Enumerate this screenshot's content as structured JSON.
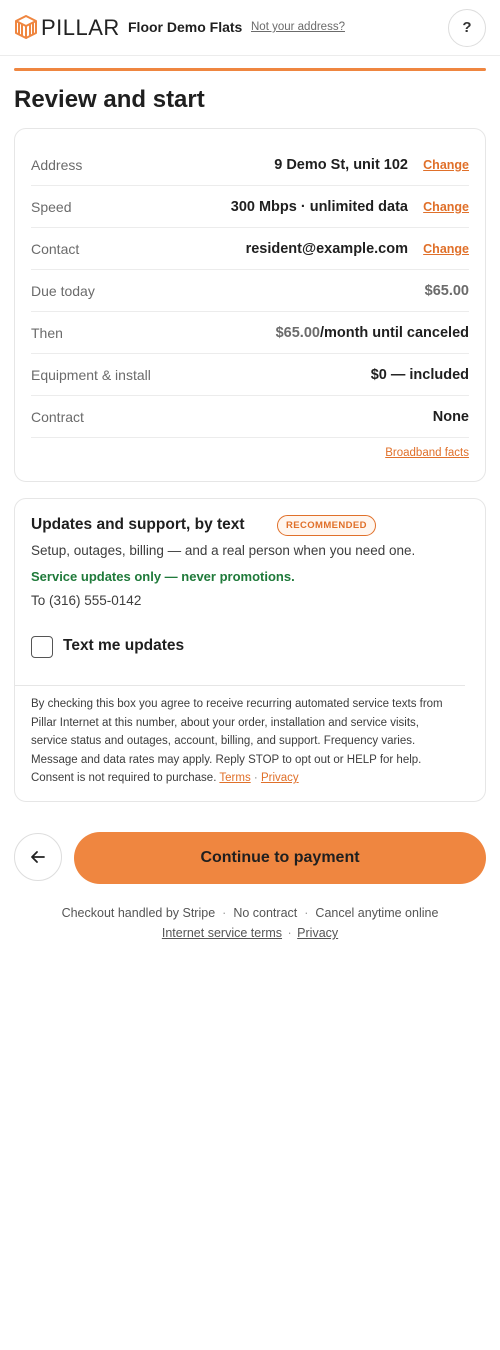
{
  "header": {
    "brand": "PILLAR",
    "property": "Floor Demo Flats",
    "not_address_link": "Not your address?",
    "help_label": "?"
  },
  "page_title": "Review and start",
  "review": {
    "rows": [
      {
        "label": "Address",
        "value": "9 Demo St, unit 102",
        "action": "Change"
      },
      {
        "label": "Speed",
        "value": "300 Mbps · unlimited data",
        "action": "Change"
      },
      {
        "label": "Contact",
        "value": "resident@example.com",
        "action": "Change"
      },
      {
        "label": "Due today",
        "value": "$65.00"
      },
      {
        "label": "Then",
        "value_price": "$65.00",
        "value_suffix": "/month until canceled"
      },
      {
        "label": "Equipment & install",
        "value": "$0 — included"
      },
      {
        "label": "Contract",
        "value": "None"
      }
    ],
    "broadband_link": "Broadband facts"
  },
  "sms": {
    "title": "Updates and support, by text",
    "badge": "RECOMMENDED",
    "description": "Setup, outages, billing — and a real person when you need one.",
    "note": "Service updates only — never promotions.",
    "to": "To (316) 555-0142",
    "checkbox_label": "Text me updates",
    "checkbox_checked": false,
    "consent_text": "By checking this box you agree to receive recurring automated service texts from Pillar Internet at this number, about your order, installation and service visits, service status and outages, account, billing, and support. Frequency varies. Message and data rates may apply. Reply STOP to opt out or HELP for help. Consent is not required to purchase.",
    "terms_link": "Terms",
    "privacy_link": "Privacy",
    "separator": "·"
  },
  "actions": {
    "back_icon": "arrow-left-icon",
    "continue_label": "Continue to payment"
  },
  "footer": {
    "items": [
      "Checkout handled by Stripe",
      "No contract",
      "Cancel anytime online"
    ],
    "separator": "·",
    "terms_link": "Internet service terms",
    "privacy_link": "Privacy"
  },
  "colors": {
    "accent": "#ef8640",
    "link": "#e0702a",
    "success": "#1f7a3a"
  }
}
